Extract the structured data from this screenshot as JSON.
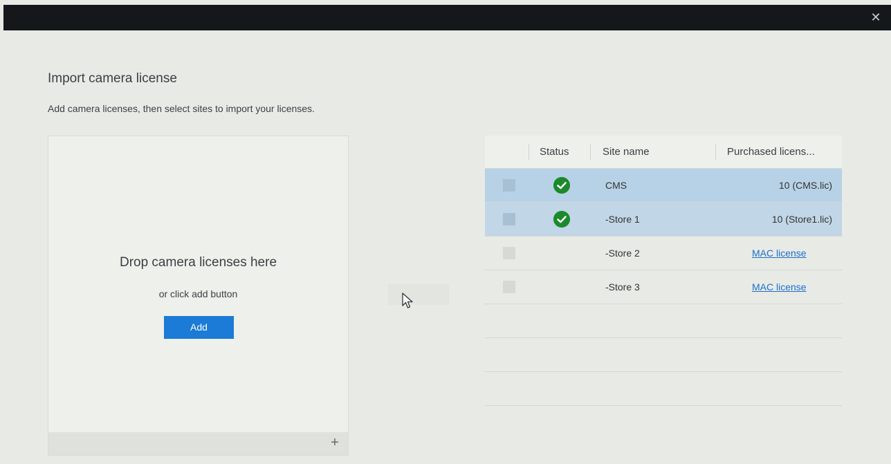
{
  "window": {
    "close_glyph": "✕"
  },
  "dialog": {
    "title": "Import camera license",
    "subtitle": "Add camera licenses, then select sites to import your licenses."
  },
  "dropzone": {
    "title": "Drop camera licenses here",
    "subtitle": "or click add button",
    "add_label": "Add",
    "plus_glyph": "+"
  },
  "table": {
    "columns": [
      "Status",
      "Site name",
      "Purchased licens..."
    ],
    "rows": [
      {
        "site": "CMS",
        "status": "ok",
        "license": "10 (CMS.lic)",
        "license_is_link": false,
        "selected": true
      },
      {
        "site": "-Store 1",
        "status": "ok",
        "license": "10 (Store1.lic)",
        "license_is_link": false,
        "selected": true
      },
      {
        "site": "-Store 2",
        "status": "",
        "license": "MAC license",
        "license_is_link": true,
        "selected": false
      },
      {
        "site": "-Store 3",
        "status": "",
        "license": "MAC license",
        "license_is_link": true,
        "selected": false
      }
    ]
  },
  "colors": {
    "accent": "#1b7bd6",
    "status_ok": "#1a8a2b",
    "selected_row": "#b7d2e6",
    "link": "#1b6fd1"
  }
}
